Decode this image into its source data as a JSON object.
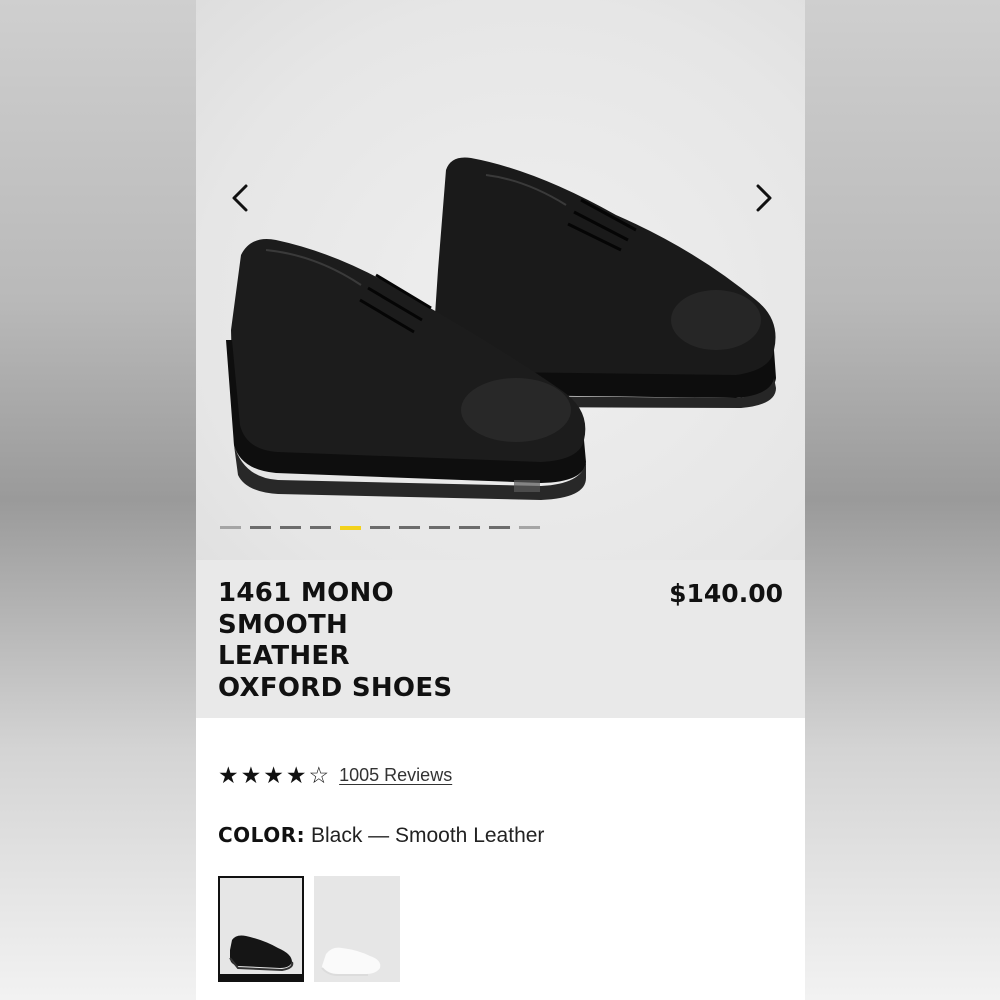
{
  "product": {
    "title_lines": [
      "1461 MONO",
      "SMOOTH",
      "LEATHER",
      "OXFORD SHOES"
    ],
    "price": "$140.00",
    "image_count": 11,
    "active_image_index": 4
  },
  "reviews": {
    "rating": 4,
    "max_rating": 5,
    "link_text": "1005 Reviews"
  },
  "color": {
    "label": "COLOR:",
    "value": "Black — Smooth Leather",
    "swatches": [
      "Black — Smooth Leather",
      "White"
    ]
  },
  "icons": {
    "prev": "chevron-left-icon",
    "next": "chevron-right-icon",
    "star": "star-icon"
  },
  "colors": {
    "accent": "#f3d21c",
    "text": "#111111",
    "hero_bg": "#e9e9e9"
  }
}
